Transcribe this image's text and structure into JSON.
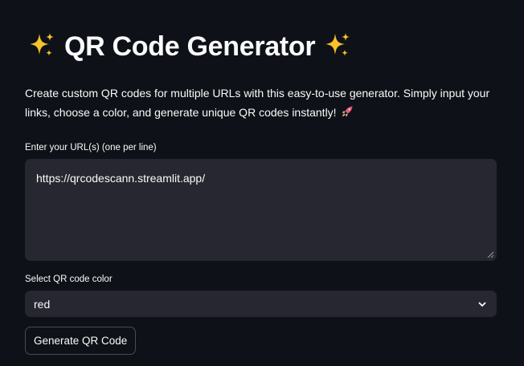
{
  "header": {
    "title": "QR Code Generator",
    "title_icon": "sparkles-icon"
  },
  "description": {
    "text": "Create custom QR codes for multiple URLs with this easy-to-use generator. Simply input your links, choose a color, and generate unique QR codes instantly!",
    "trailing_icon": "rocket-icon"
  },
  "url_input": {
    "label": "Enter your URL(s) (one per line)",
    "value": "https://qrcodescann.streamlit.app/"
  },
  "color_select": {
    "label": "Select QR code color",
    "selected": "red"
  },
  "actions": {
    "generate_label": "Generate QR Code"
  },
  "colors": {
    "background": "#0e1117",
    "input_background": "#262730",
    "text": "#fafafa",
    "sparkle": "#f8c22c",
    "rocket": "#e8566f"
  }
}
